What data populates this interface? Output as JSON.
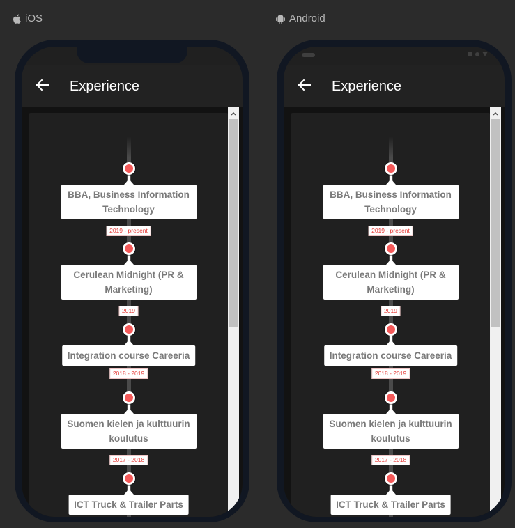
{
  "platforms": {
    "ios": {
      "label": "iOS",
      "icon": "apple-icon"
    },
    "android": {
      "label": "Android",
      "icon": "android-icon"
    }
  },
  "appbar": {
    "title": "Experience",
    "back_icon": "arrow-left-icon"
  },
  "timeline": {
    "items": [
      {
        "title": "BBA, Business Information Technology",
        "date": "2019 - present"
      },
      {
        "title": "Cerulean Midnight (PR & Marketing)",
        "date": "2019"
      },
      {
        "title": "Integration course Careeria",
        "date": "2018 - 2019"
      },
      {
        "title": "Suomen kielen ja kulttuurin koulutus",
        "date": "2017 - 2018"
      },
      {
        "title": "ICT Truck & Trailer Parts",
        "date": ""
      }
    ]
  },
  "colors": {
    "background": "#2b2b2b",
    "phone_frame": "#111722",
    "appbar": "#222222",
    "card": "#202020",
    "node_fill": "#f45a5a",
    "date_text": "#e53935",
    "title_text": "#7a7a7a"
  }
}
